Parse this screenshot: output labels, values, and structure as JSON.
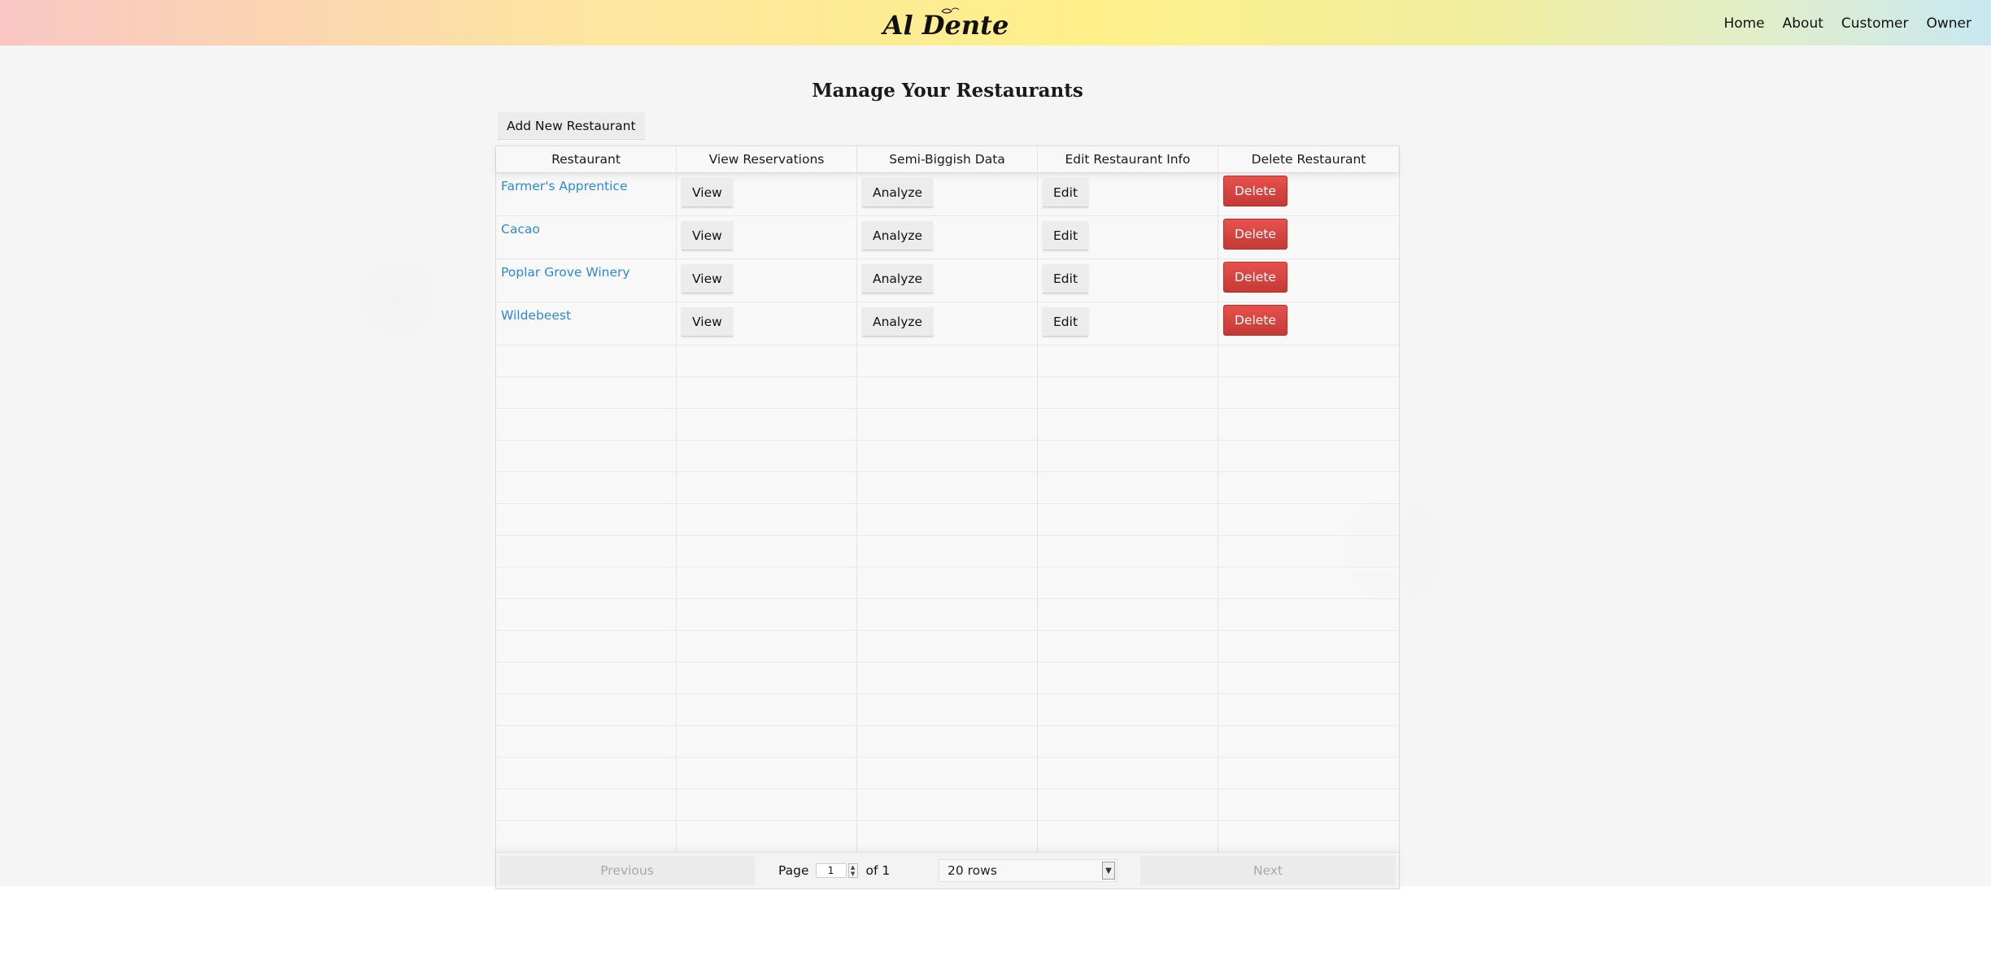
{
  "header": {
    "logo_text": "Al Dente",
    "nav": [
      "Home",
      "About",
      "Customer",
      "Owner"
    ]
  },
  "main": {
    "title": "Manage Your Restaurants",
    "add_button": "Add New Restaurant",
    "columns": [
      "Restaurant",
      "View Reservations",
      "Semi-Biggish Data",
      "Edit Restaurant Info",
      "Delete Restaurant"
    ],
    "rows": [
      {
        "name": "Farmer's Apprentice",
        "view": "View",
        "analyze": "Analyze",
        "edit": "Edit",
        "delete": "Delete"
      },
      {
        "name": "Cacao",
        "view": "View",
        "analyze": "Analyze",
        "edit": "Edit",
        "delete": "Delete"
      },
      {
        "name": "Poplar Grove Winery",
        "view": "View",
        "analyze": "Analyze",
        "edit": "Edit",
        "delete": "Delete"
      },
      {
        "name": "Wildebeest",
        "view": "View",
        "analyze": "Analyze",
        "edit": "Edit",
        "delete": "Delete"
      }
    ]
  },
  "pager": {
    "previous": "Previous",
    "page_label": "Page",
    "page_value": "1",
    "of_label": "of 1",
    "rows_option": "20 rows",
    "next": "Next"
  },
  "colors": {
    "link": "#2a8ad8",
    "delete": "#d9534f"
  }
}
